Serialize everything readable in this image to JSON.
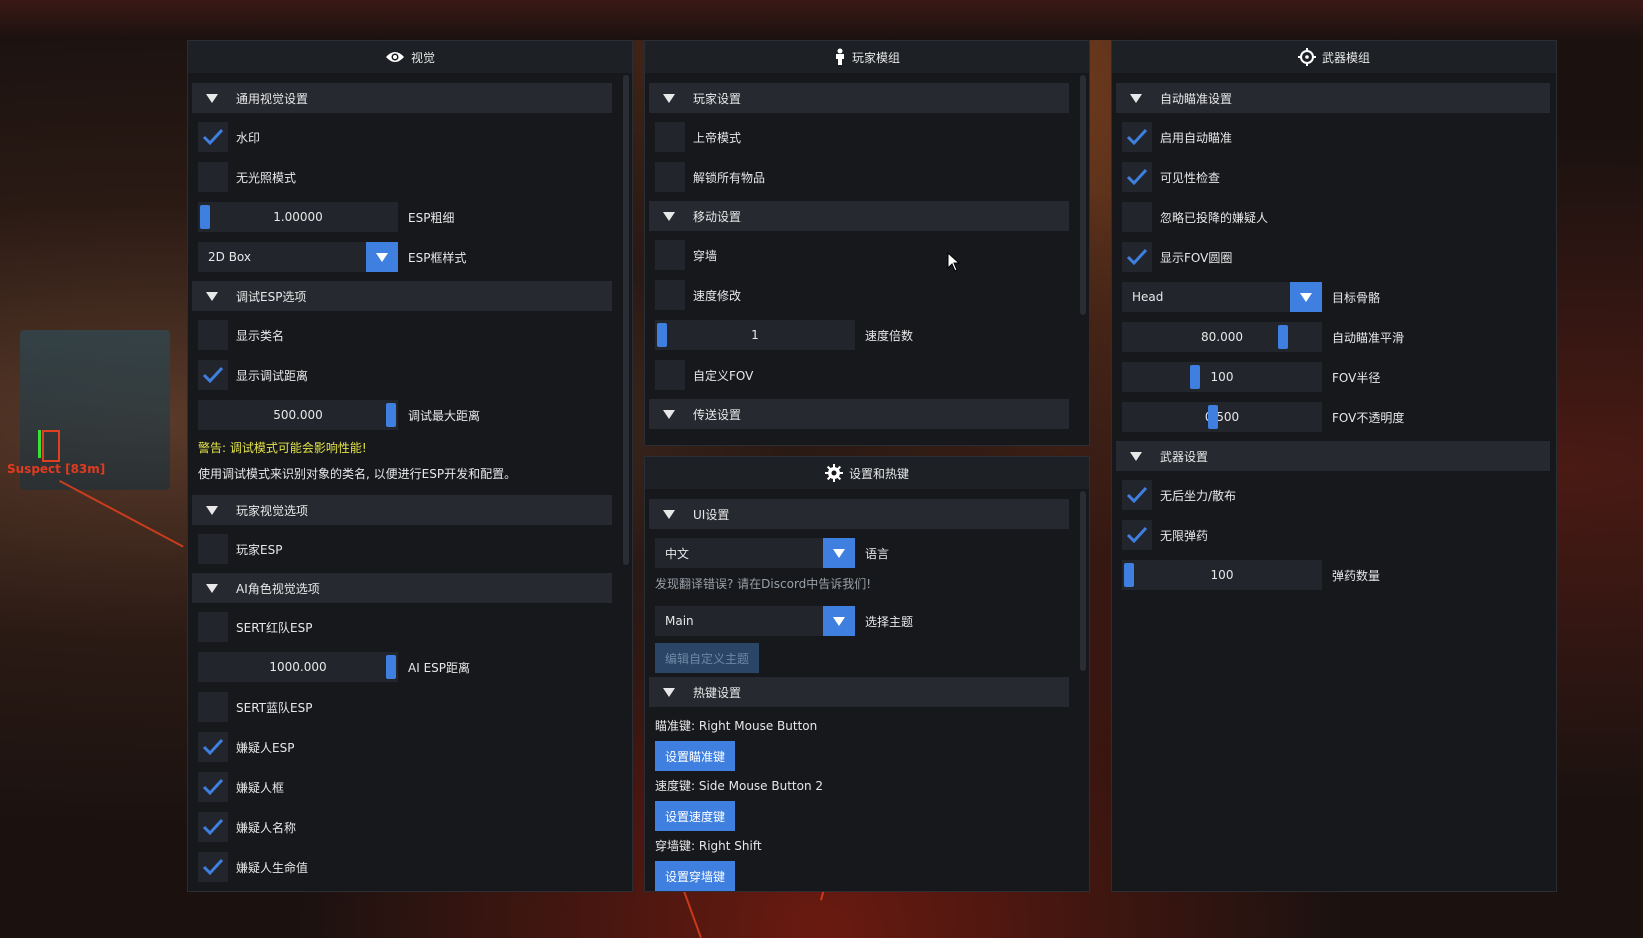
{
  "background": {
    "suspect_label": "Suspect [83m]"
  },
  "colors": {
    "accent": "#3f7fe0",
    "warning": "#e3e34a",
    "enemy": "#e03a20"
  },
  "visual": {
    "title": "视觉",
    "icon": "eye-icon",
    "general": {
      "header": "通用视觉设置",
      "watermark": {
        "label": "水印",
        "checked": true
      },
      "no_light": {
        "label": "无光照模式",
        "checked": false
      },
      "esp_thickness": {
        "value": "1.00000",
        "label": "ESP粗细",
        "fill": 0.0
      },
      "esp_style": {
        "value": "2D Box",
        "label": "ESP框样式"
      }
    },
    "debug": {
      "header": "调试ESP选项",
      "show_class": {
        "label": "显示类名",
        "checked": false
      },
      "show_distance": {
        "label": "显示调试距离",
        "checked": true
      },
      "max_distance": {
        "value": "500.000",
        "label": "调试最大距离",
        "fill": 1.0
      },
      "warning": "警告: 调试模式可能会影响性能!",
      "note": "使用调试模式来识别对象的类名, 以便进行ESP开发和配置。"
    },
    "player": {
      "header": "玩家视觉选项",
      "player_esp": {
        "label": "玩家ESP",
        "checked": false
      }
    },
    "ai": {
      "header": "AI角色视觉选项",
      "sert_red": {
        "label": "SERT红队ESP",
        "checked": false
      },
      "ai_distance": {
        "value": "1000.000",
        "label": "AI ESP距离",
        "fill": 1.0
      },
      "sert_blue": {
        "label": "SERT蓝队ESP",
        "checked": false
      },
      "suspect_esp": {
        "label": "嫌疑人ESP",
        "checked": true
      },
      "suspect_box": {
        "label": "嫌疑人框",
        "checked": true
      },
      "suspect_name": {
        "label": "嫌疑人名称",
        "checked": true
      },
      "suspect_hp": {
        "label": "嫌疑人生命值",
        "checked": true
      }
    }
  },
  "player_module": {
    "title": "玩家模组",
    "icon": "person-icon",
    "player": {
      "header": "玩家设置",
      "god_mode": {
        "label": "上帝模式",
        "checked": false
      },
      "unlock_all": {
        "label": "解锁所有物品",
        "checked": false
      }
    },
    "movement": {
      "header": "移动设置",
      "noclip": {
        "label": "穿墙",
        "checked": false
      },
      "speed_mod": {
        "label": "速度修改",
        "checked": false
      },
      "speed_mult": {
        "value": "1",
        "label": "速度倍数",
        "fill": 0.0
      },
      "custom_fov": {
        "label": "自定义FOV",
        "checked": false
      }
    },
    "teleport": {
      "header": "传送设置"
    }
  },
  "settings": {
    "title": "设置和热键",
    "icon": "gear-icon",
    "ui": {
      "header": "UI设置",
      "language": {
        "value": "中文",
        "label": "语言"
      },
      "translation_note": "发现翻译错误? 请在Discord中告诉我们!",
      "theme": {
        "value": "Main",
        "label": "选择主题"
      },
      "edit_theme": "编辑自定义主题"
    },
    "hotkeys": {
      "header": "热键设置",
      "aim_key": "瞄准键: Right Mouse Button",
      "set_aim": "设置瞄准键",
      "speed_key": "速度键: Side Mouse Button 2",
      "set_speed": "设置速度键",
      "noclip_key": "穿墙键: Right Shift",
      "set_noclip": "设置穿墙键"
    }
  },
  "weapon_module": {
    "title": "武器模组",
    "icon": "crosshair-icon",
    "aimbot": {
      "header": "自动瞄准设置",
      "enable": {
        "label": "启用自动瞄准",
        "checked": true
      },
      "visibility": {
        "label": "可见性检查",
        "checked": true
      },
      "ignore_surrendered": {
        "label": "忽略已投降的嫌疑人",
        "checked": false
      },
      "show_fov": {
        "label": "显示FOV圆圈",
        "checked": true
      },
      "target_bone": {
        "value": "Head",
        "label": "目标骨骼"
      },
      "smoothing": {
        "value": "80.000",
        "label": "自动瞄准平滑",
        "fill": 0.8
      },
      "fov_radius": {
        "value": "100",
        "label": "FOV半径",
        "fill": 0.35
      },
      "fov_opacity": {
        "value": "0.500",
        "label": "FOV不透明度",
        "fill": 0.45
      }
    },
    "weapon": {
      "header": "武器设置",
      "no_recoil": {
        "label": "无后坐力/散布",
        "checked": true
      },
      "infinite_ammo": {
        "label": "无限弹药",
        "checked": true
      },
      "ammo_count": {
        "value": "100",
        "label": "弹药数量",
        "fill": 0.0
      }
    }
  }
}
